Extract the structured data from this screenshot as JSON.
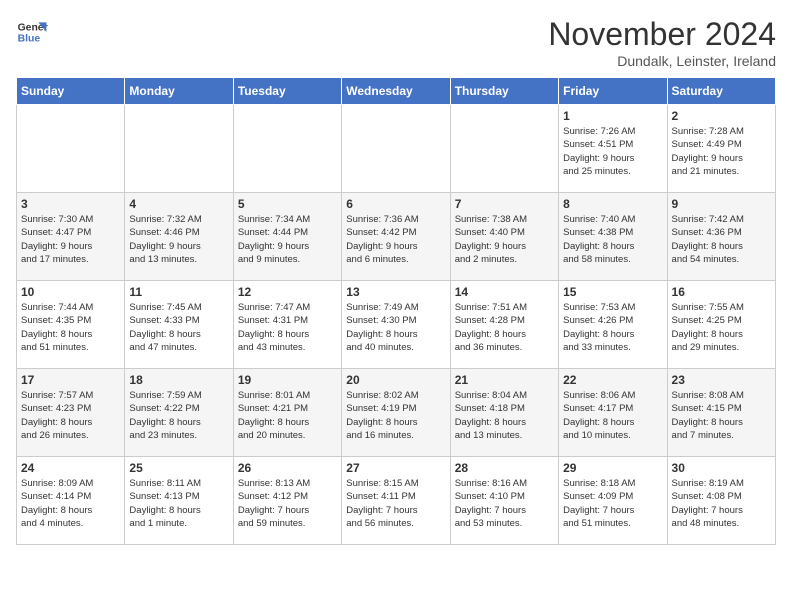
{
  "logo": {
    "line1": "General",
    "line2": "Blue"
  },
  "title": "November 2024",
  "subtitle": "Dundalk, Leinster, Ireland",
  "headers": [
    "Sunday",
    "Monday",
    "Tuesday",
    "Wednesday",
    "Thursday",
    "Friday",
    "Saturday"
  ],
  "weeks": [
    [
      {
        "day": "",
        "info": ""
      },
      {
        "day": "",
        "info": ""
      },
      {
        "day": "",
        "info": ""
      },
      {
        "day": "",
        "info": ""
      },
      {
        "day": "",
        "info": ""
      },
      {
        "day": "1",
        "info": "Sunrise: 7:26 AM\nSunset: 4:51 PM\nDaylight: 9 hours\nand 25 minutes."
      },
      {
        "day": "2",
        "info": "Sunrise: 7:28 AM\nSunset: 4:49 PM\nDaylight: 9 hours\nand 21 minutes."
      }
    ],
    [
      {
        "day": "3",
        "info": "Sunrise: 7:30 AM\nSunset: 4:47 PM\nDaylight: 9 hours\nand 17 minutes."
      },
      {
        "day": "4",
        "info": "Sunrise: 7:32 AM\nSunset: 4:46 PM\nDaylight: 9 hours\nand 13 minutes."
      },
      {
        "day": "5",
        "info": "Sunrise: 7:34 AM\nSunset: 4:44 PM\nDaylight: 9 hours\nand 9 minutes."
      },
      {
        "day": "6",
        "info": "Sunrise: 7:36 AM\nSunset: 4:42 PM\nDaylight: 9 hours\nand 6 minutes."
      },
      {
        "day": "7",
        "info": "Sunrise: 7:38 AM\nSunset: 4:40 PM\nDaylight: 9 hours\nand 2 minutes."
      },
      {
        "day": "8",
        "info": "Sunrise: 7:40 AM\nSunset: 4:38 PM\nDaylight: 8 hours\nand 58 minutes."
      },
      {
        "day": "9",
        "info": "Sunrise: 7:42 AM\nSunset: 4:36 PM\nDaylight: 8 hours\nand 54 minutes."
      }
    ],
    [
      {
        "day": "10",
        "info": "Sunrise: 7:44 AM\nSunset: 4:35 PM\nDaylight: 8 hours\nand 51 minutes."
      },
      {
        "day": "11",
        "info": "Sunrise: 7:45 AM\nSunset: 4:33 PM\nDaylight: 8 hours\nand 47 minutes."
      },
      {
        "day": "12",
        "info": "Sunrise: 7:47 AM\nSunset: 4:31 PM\nDaylight: 8 hours\nand 43 minutes."
      },
      {
        "day": "13",
        "info": "Sunrise: 7:49 AM\nSunset: 4:30 PM\nDaylight: 8 hours\nand 40 minutes."
      },
      {
        "day": "14",
        "info": "Sunrise: 7:51 AM\nSunset: 4:28 PM\nDaylight: 8 hours\nand 36 minutes."
      },
      {
        "day": "15",
        "info": "Sunrise: 7:53 AM\nSunset: 4:26 PM\nDaylight: 8 hours\nand 33 minutes."
      },
      {
        "day": "16",
        "info": "Sunrise: 7:55 AM\nSunset: 4:25 PM\nDaylight: 8 hours\nand 29 minutes."
      }
    ],
    [
      {
        "day": "17",
        "info": "Sunrise: 7:57 AM\nSunset: 4:23 PM\nDaylight: 8 hours\nand 26 minutes."
      },
      {
        "day": "18",
        "info": "Sunrise: 7:59 AM\nSunset: 4:22 PM\nDaylight: 8 hours\nand 23 minutes."
      },
      {
        "day": "19",
        "info": "Sunrise: 8:01 AM\nSunset: 4:21 PM\nDaylight: 8 hours\nand 20 minutes."
      },
      {
        "day": "20",
        "info": "Sunrise: 8:02 AM\nSunset: 4:19 PM\nDaylight: 8 hours\nand 16 minutes."
      },
      {
        "day": "21",
        "info": "Sunrise: 8:04 AM\nSunset: 4:18 PM\nDaylight: 8 hours\nand 13 minutes."
      },
      {
        "day": "22",
        "info": "Sunrise: 8:06 AM\nSunset: 4:17 PM\nDaylight: 8 hours\nand 10 minutes."
      },
      {
        "day": "23",
        "info": "Sunrise: 8:08 AM\nSunset: 4:15 PM\nDaylight: 8 hours\nand 7 minutes."
      }
    ],
    [
      {
        "day": "24",
        "info": "Sunrise: 8:09 AM\nSunset: 4:14 PM\nDaylight: 8 hours\nand 4 minutes."
      },
      {
        "day": "25",
        "info": "Sunrise: 8:11 AM\nSunset: 4:13 PM\nDaylight: 8 hours\nand 1 minute."
      },
      {
        "day": "26",
        "info": "Sunrise: 8:13 AM\nSunset: 4:12 PM\nDaylight: 7 hours\nand 59 minutes."
      },
      {
        "day": "27",
        "info": "Sunrise: 8:15 AM\nSunset: 4:11 PM\nDaylight: 7 hours\nand 56 minutes."
      },
      {
        "day": "28",
        "info": "Sunrise: 8:16 AM\nSunset: 4:10 PM\nDaylight: 7 hours\nand 53 minutes."
      },
      {
        "day": "29",
        "info": "Sunrise: 8:18 AM\nSunset: 4:09 PM\nDaylight: 7 hours\nand 51 minutes."
      },
      {
        "day": "30",
        "info": "Sunrise: 8:19 AM\nSunset: 4:08 PM\nDaylight: 7 hours\nand 48 minutes."
      }
    ]
  ]
}
